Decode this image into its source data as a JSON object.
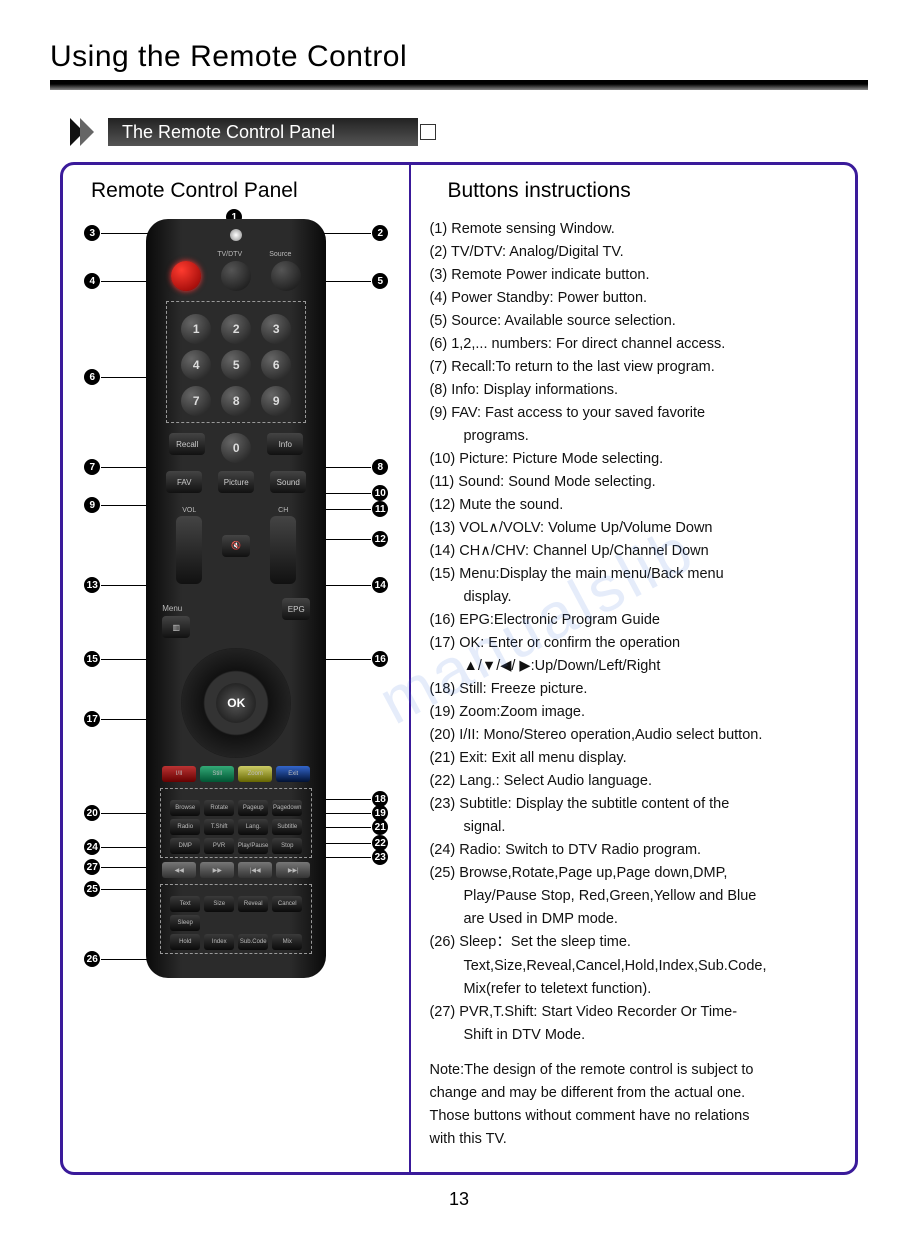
{
  "page_title": "Using the Remote Control",
  "section_title": "The Remote Control Panel",
  "left_column_title": "Remote Control Panel",
  "right_column_title": "Buttons instructions",
  "page_number": "13",
  "remote": {
    "power_icon": "⏻",
    "top_labels": {
      "tvdtv": "TV/DTV",
      "source": "Source"
    },
    "numpad": [
      "1",
      "2",
      "3",
      "4",
      "5",
      "6",
      "7",
      "8",
      "9",
      "0"
    ],
    "recall": "Recall",
    "info": "Info",
    "fav": "FAV",
    "picture": "Picture",
    "sound": "Sound",
    "vol": "VOL",
    "ch": "CH",
    "mute": "🔇",
    "menu": "Menu",
    "epg": "EPG",
    "ok": "OK",
    "color_row": [
      "I/II",
      "Still",
      "Zoom",
      "Exit"
    ],
    "row_a": [
      "Browse",
      "Rotate",
      "Pageup",
      "Pagedown"
    ],
    "row_b": [
      "Radio",
      "T.Shift",
      "Lang.",
      "Subtitle"
    ],
    "row_c": [
      "DMP",
      "PVR",
      "Play/Pause",
      "Stop"
    ],
    "transport": [
      "◀◀",
      "▶▶",
      "|◀◀",
      "▶▶|"
    ],
    "row_d": [
      "Text",
      "Size",
      "Reveal",
      "Cancel"
    ],
    "row_e1": "Sleep",
    "row_e": [
      "Hold",
      "Index",
      "Sub.Code",
      "Mix"
    ]
  },
  "callouts": {
    "c1": "1",
    "c2": "2",
    "c3": "3",
    "c4": "4",
    "c5": "5",
    "c6": "6",
    "c7": "7",
    "c8": "8",
    "c9": "9",
    "c10": "10",
    "c11": "11",
    "c12": "12",
    "c13": "13",
    "c14": "14",
    "c15": "15",
    "c16": "16",
    "c17": "17",
    "c18": "18",
    "c19": "19",
    "c20": "20",
    "c21": "21",
    "c22": "22",
    "c23": "23",
    "c24": "24",
    "c25": "25",
    "c26": "26",
    "c27": "27"
  },
  "instructions": [
    "(1)  Remote sensing Window.",
    "(2)  TV/DTV: Analog/Digital TV.",
    "(3)  Remote Power indicate button.",
    "(4)  Power Standby: Power button.",
    "(5)  Source: Available source selection.",
    "(6) 1,2,... numbers: For direct channel access.",
    "(7)  Recall:To return to the last view program.",
    "(8)  Info: Display informations.",
    "(9)  FAV: Fast access to your saved favorite",
    "programs.",
    "(10)  Picture: Picture Mode selecting.",
    "(11)  Sound: Sound Mode selecting.",
    "(12)  Mute the sound.",
    "(13)  VOL∧/VOLV: Volume Up/Volume Down",
    "(14)  CH∧/CHV: Channel Up/Channel Down",
    "(15)  Menu:Display the main menu/Back menu",
    "display.",
    "(16)  EPG:Electronic Program Guide",
    "(17)  OK: Enter or confirm the operation",
    "▲/▼/◀/ ▶:Up/Down/Left/Right",
    "(18)  Still: Freeze picture.",
    "(19)  Zoom:Zoom image.",
    "(20)  I/II: Mono/Stereo operation,Audio select button.",
    "(21)  Exit: Exit all menu display.",
    "(22)  Lang.: Select Audio language.",
    "(23)  Subtitle: Display the subtitle  content of the",
    "signal.",
    "(24)  Radio: Switch to DTV Radio program.",
    "(25)  Browse,Rotate,Page up,Page down,DMP,",
    "Play/Pause Stop, Red,Green,Yellow and Blue",
    "are Used in DMP        mode.",
    "(26)  Sleep：Set the sleep time.",
    "Text,Size,Reveal,Cancel,Hold,Index,Sub.Code,",
    "Mix(refer to teletext function).",
    "(27)   PVR,T.Shift: Start Video Recorder Or Time-",
    "Shift in DTV Mode."
  ],
  "indent_indices": [
    9,
    16,
    19,
    26,
    29,
    30,
    32,
    33,
    35
  ],
  "note_lines": [
    "Note:The design of the remote control is subject to",
    "change and may be different from the actual one.",
    "Those buttons without comment have no relations",
    "with this TV."
  ]
}
